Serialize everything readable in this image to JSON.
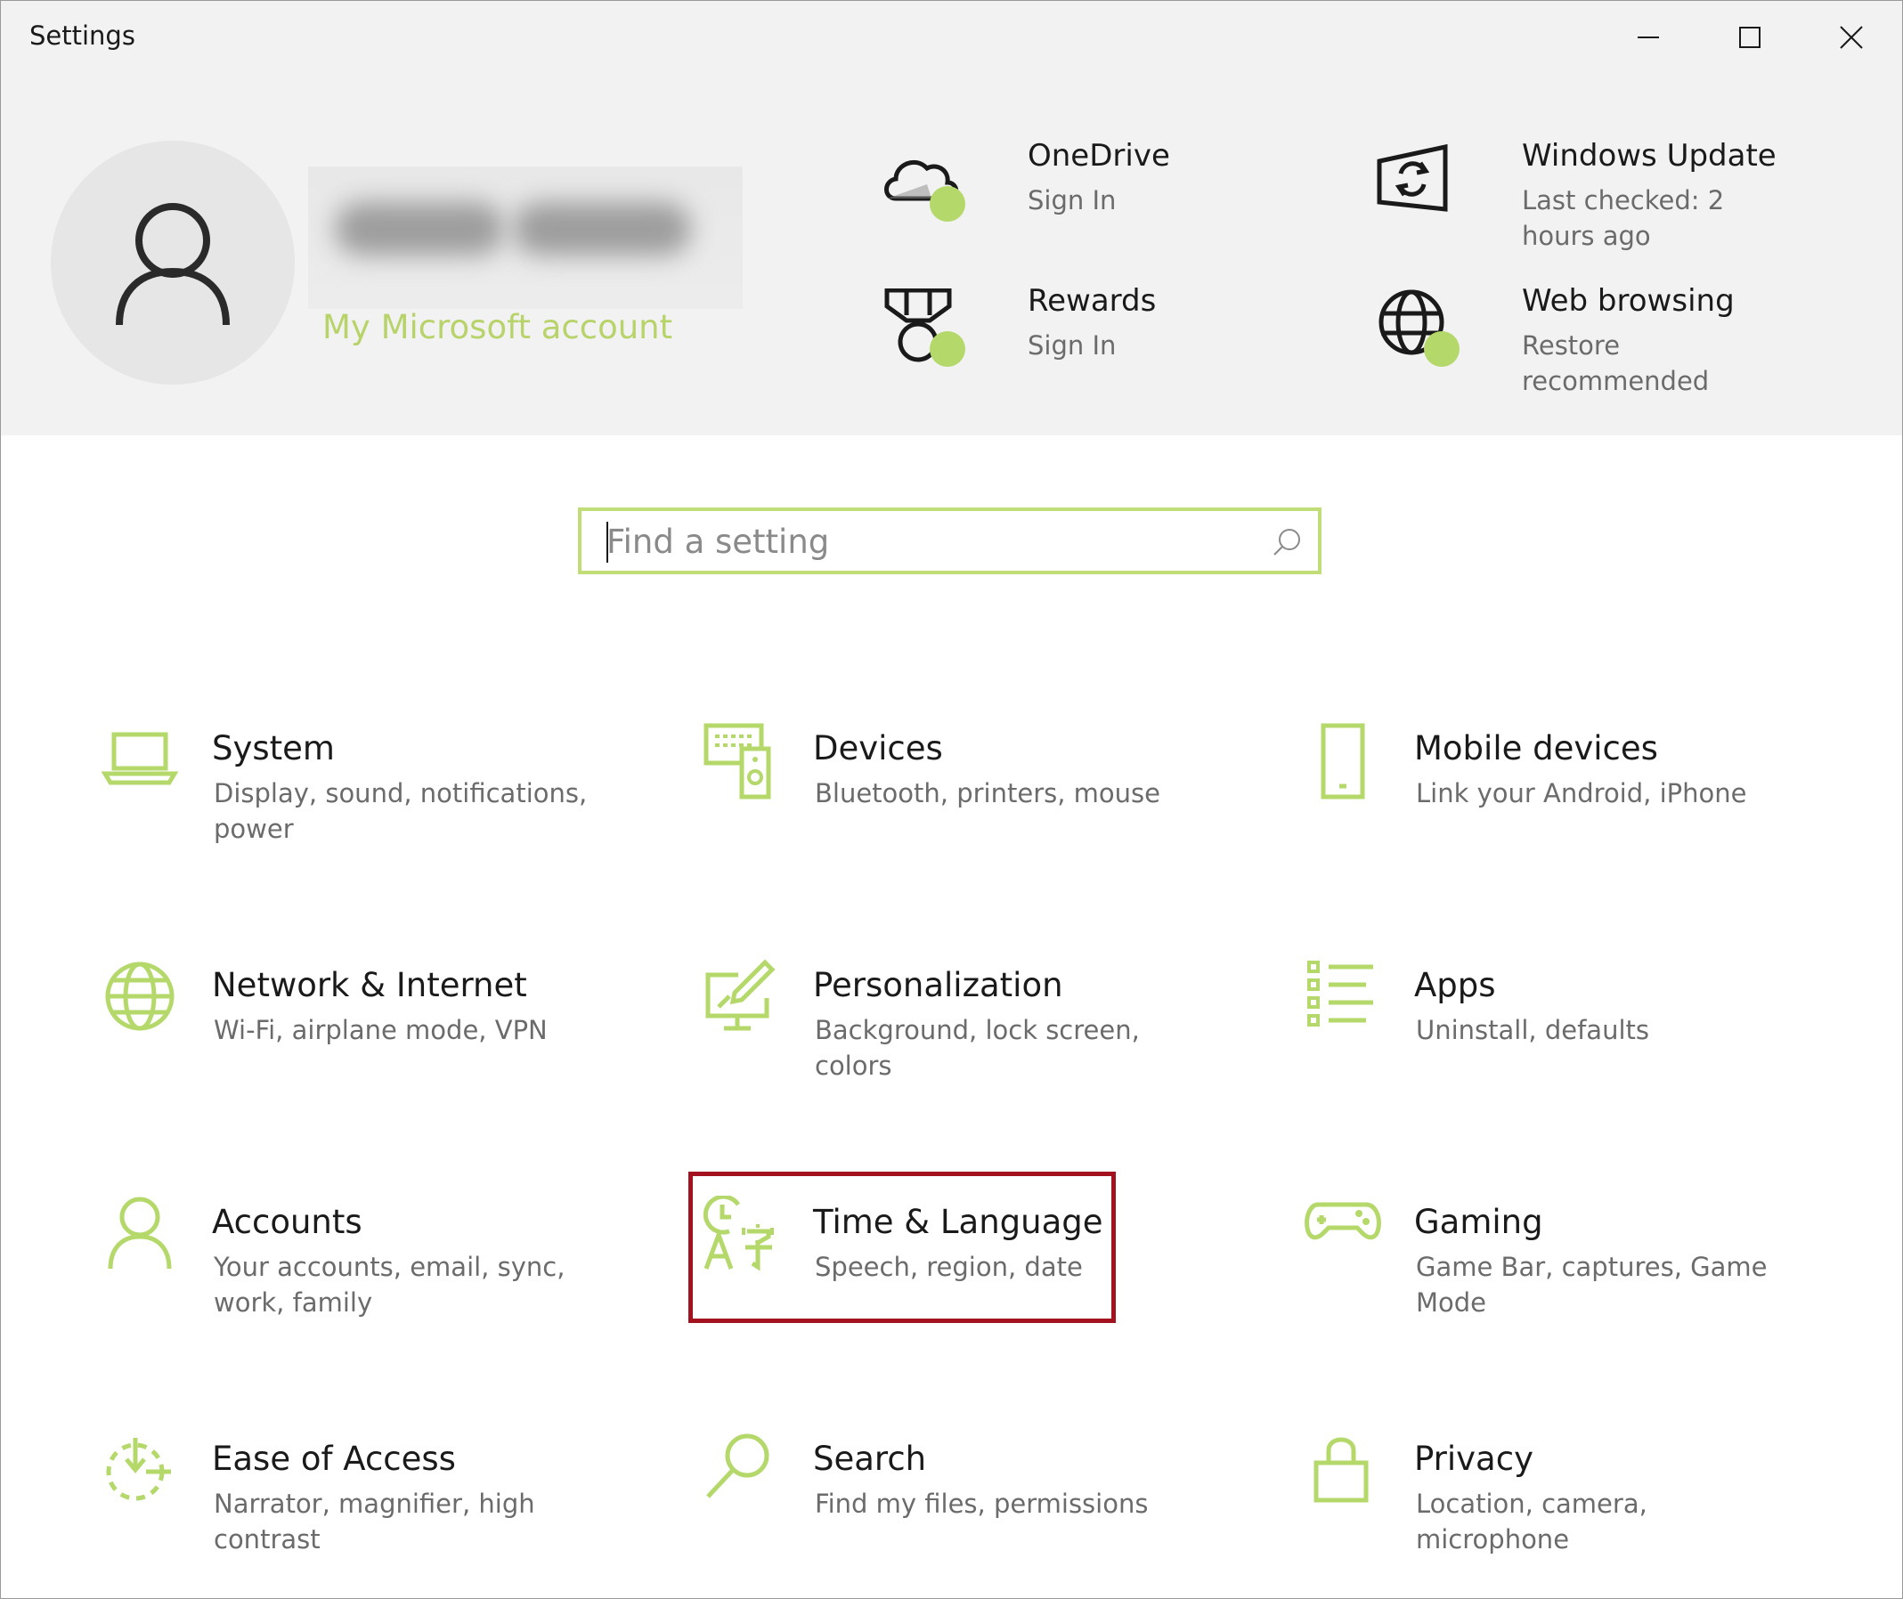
{
  "window": {
    "title": "Settings",
    "controls": [
      "minimize",
      "maximize",
      "close"
    ]
  },
  "colors": {
    "accent": "#b5d86a",
    "header_bg": "#f2f2f2",
    "highlight_border": "#a3131f"
  },
  "account": {
    "link": "My Microsoft account"
  },
  "quick_links": [
    {
      "title": "OneDrive",
      "subtitle": "Sign In",
      "icon": "onedrive-cloud-icon"
    },
    {
      "title": "Windows Update",
      "subtitle": "Last checked: 2 hours ago",
      "icon": "windows-update-icon"
    },
    {
      "title": "Rewards",
      "subtitle": "Sign In",
      "icon": "rewards-medal-icon"
    },
    {
      "title": "Web browsing",
      "subtitle": "Restore recommended",
      "icon": "web-browsing-globe-icon"
    }
  ],
  "search": {
    "placeholder": "Find a setting",
    "value": ""
  },
  "categories": [
    {
      "title": "System",
      "subtitle": "Display, sound, notifications, power",
      "icon": "laptop-icon"
    },
    {
      "title": "Devices",
      "subtitle": "Bluetooth, printers, mouse",
      "icon": "devices-keyboard-icon"
    },
    {
      "title": "Mobile devices",
      "subtitle": "Link your Android, iPhone",
      "icon": "phone-icon"
    },
    {
      "title": "Network & Internet",
      "subtitle": "Wi-Fi, airplane mode, VPN",
      "icon": "globe-icon"
    },
    {
      "title": "Personalization",
      "subtitle": "Background, lock screen, colors",
      "icon": "paint-brush-icon"
    },
    {
      "title": "Apps",
      "subtitle": "Uninstall, defaults",
      "icon": "apps-list-icon"
    },
    {
      "title": "Accounts",
      "subtitle": "Your accounts, email, sync, work, family",
      "icon": "person-icon"
    },
    {
      "title": "Time & Language",
      "subtitle": "Speech, region, date",
      "icon": "time-language-icon"
    },
    {
      "title": "Gaming",
      "subtitle": "Game Bar, captures, Game Mode",
      "icon": "gamepad-icon"
    },
    {
      "title": "Ease of Access",
      "subtitle": "Narrator, magnifier, high contrast",
      "icon": "ease-of-access-icon"
    },
    {
      "title": "Search",
      "subtitle": "Find my files, permissions",
      "icon": "magnifier-icon"
    },
    {
      "title": "Privacy",
      "subtitle": "Location, camera, microphone",
      "icon": "padlock-icon"
    }
  ],
  "highlighted_category": "Time & Language"
}
